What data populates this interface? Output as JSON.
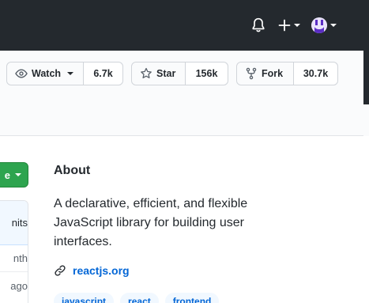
{
  "header": {
    "icons": [
      "bell-icon",
      "plus-icon",
      "avatar"
    ]
  },
  "repo_actions": {
    "watch": {
      "label": "Watch",
      "count": "6.7k",
      "icon": "eye-icon"
    },
    "star": {
      "label": "Star",
      "count": "156k",
      "icon": "star-icon"
    },
    "fork": {
      "label": "Fork",
      "count": "30.7k",
      "icon": "repo-forked-icon"
    }
  },
  "code_button": {
    "label": "e"
  },
  "commits_panel": {
    "header": "nits",
    "row1": "nth",
    "row2": "ago"
  },
  "about": {
    "title": "About",
    "description": "A declarative, efficient, and flexible JavaScript library for building user interfaces.",
    "website": "reactjs.org",
    "topics": [
      "javascript",
      "react",
      "frontend"
    ]
  },
  "colors": {
    "header_bg": "#24292e",
    "primary_green": "#2ea44f",
    "link_blue": "#0366d6",
    "topic_bg": "#f1f8ff"
  }
}
